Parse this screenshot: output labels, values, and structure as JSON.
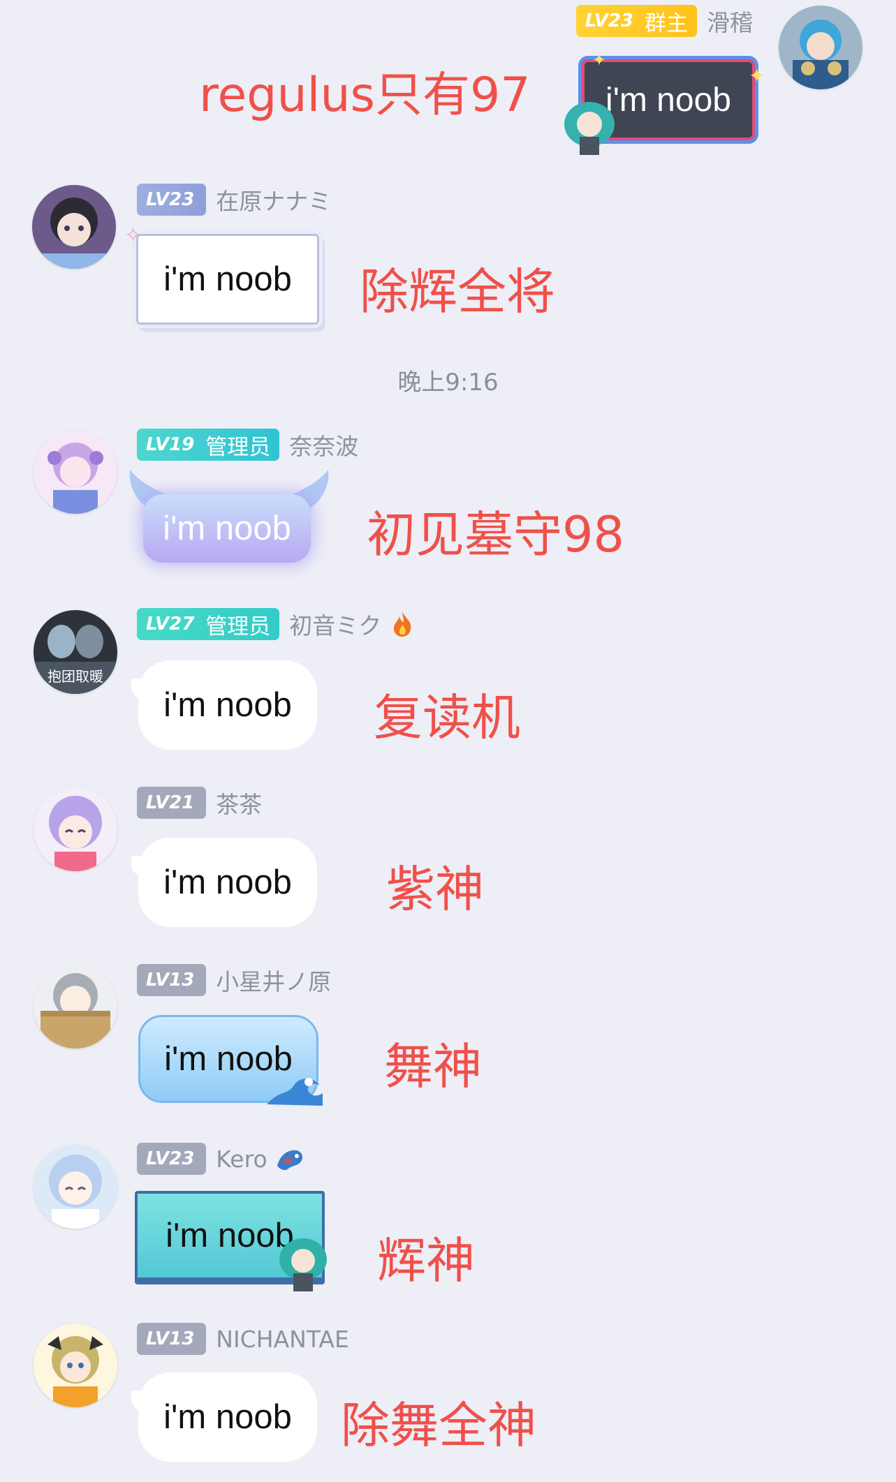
{
  "messages": [
    {
      "level": "LV23",
      "role": "群主",
      "name": "滑稽",
      "text": "i'm noob",
      "annotation": "regulus只有97"
    },
    {
      "level": "LV23",
      "role": "",
      "name": "在原ナナミ",
      "text": "i'm noob",
      "annotation": "除辉全将"
    },
    {
      "level": "LV19",
      "role": "管理员",
      "name": "奈奈波",
      "text": "i'm noob",
      "annotation": "初见墓守98"
    },
    {
      "level": "LV27",
      "role": "管理员",
      "name": "初音ミク",
      "name_icon": "fire-icon",
      "avatar_caption": "抱团取暖",
      "text": "i'm noob",
      "annotation": "复读机"
    },
    {
      "level": "LV21",
      "role": "",
      "name": "茶茶",
      "text": "i'm noob",
      "annotation": "紫神"
    },
    {
      "level": "LV13",
      "role": "",
      "name": "小星井ノ原",
      "text": "i'm noob",
      "annotation": "舞神"
    },
    {
      "level": "LV23",
      "role": "",
      "name": "Kero",
      "name_icon": "dragon-icon",
      "text": "i'm noob",
      "annotation": "辉神"
    },
    {
      "level": "LV13",
      "role": "",
      "name": "NICHANTAE",
      "text": "i'm noob",
      "annotation": "除舞全神"
    }
  ],
  "timestamp": "晚上9:16",
  "colors": {
    "background": "#EDEEF6",
    "annotation": "#F0504A",
    "badge_owner": "#FFC21A",
    "badge_admin": "#34CBC7",
    "badge_default": "#A3A9BA"
  }
}
